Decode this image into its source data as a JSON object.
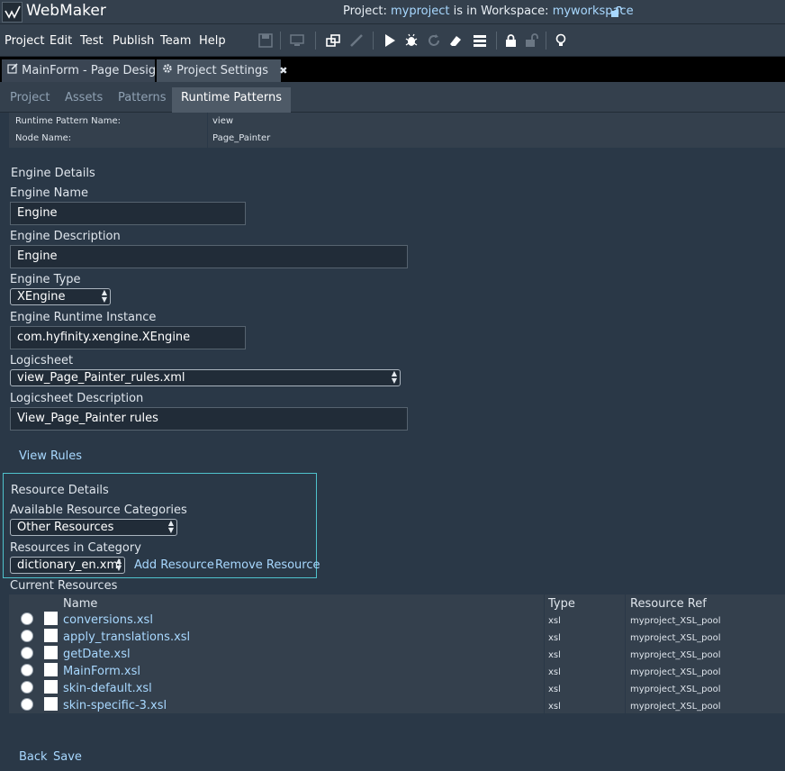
{
  "app": {
    "name": "WebMaker",
    "logo_icon": "webmaker-logo-icon"
  },
  "project_info": {
    "prefix": "Project:",
    "project": "myproject",
    "middle": "is in Workspace:",
    "workspace": "myworkspace"
  },
  "menu": [
    "Project",
    "Edit",
    "Test",
    "Publish",
    "Team",
    "Help"
  ],
  "toolbar_icons": [
    "save-icon",
    "monitor-icon",
    "windows-icon",
    "brush-icon",
    "play-icon",
    "bug-icon",
    "refresh-icon",
    "eraser-icon",
    "server-icon",
    "lock-icon",
    "unlock-icon",
    "lightbulb-icon"
  ],
  "doc_tabs": [
    {
      "label": "MainForm - Page Design",
      "icon": "edit-icon",
      "closable": false
    },
    {
      "label": "Project Settings",
      "icon": "gear-icon",
      "closable": true,
      "close_glyph": "✖"
    }
  ],
  "sub_tabs": [
    "Project",
    "Assets",
    "Patterns",
    "Runtime Patterns"
  ],
  "pattern_info": {
    "runtime_pattern_name_label": "Runtime Pattern Name:",
    "runtime_pattern_name": "view",
    "node_name_label": "Node Name:",
    "node_name": "Page_Painter"
  },
  "engine": {
    "section_title": "Engine Details",
    "name_label": "Engine Name",
    "name_value": "Engine",
    "description_label": "Engine Description",
    "description_value": "Engine",
    "type_label": "Engine Type",
    "type_value": "XEngine",
    "runtime_label": "Engine Runtime Instance",
    "runtime_value": "com.hyfinity.xengine.XEngine",
    "logicsheet_label": "Logicsheet",
    "logicsheet_value": "view_Page_Painter_rules.xml",
    "logicsheet_desc_label": "Logicsheet Description",
    "logicsheet_desc_value": "View_Page_Painter rules",
    "view_rules": "View Rules"
  },
  "resources": {
    "section_title": "Resource Details",
    "categories_label": "Available Resource Categories",
    "category_value": "Other Resources",
    "in_category_label": "Resources in Category",
    "resource_value": "dictionary_en.xml",
    "add": "Add Resource",
    "remove": "Remove Resource",
    "current_label": "Current Resources",
    "columns": [
      "Name",
      "Type",
      "Resource Ref"
    ],
    "rows": [
      {
        "name": "conversions.xsl",
        "type": "xsl",
        "ref": "myproject_XSL_pool"
      },
      {
        "name": "apply_translations.xsl",
        "type": "xsl",
        "ref": "myproject_XSL_pool"
      },
      {
        "name": "getDate.xsl",
        "type": "xsl",
        "ref": "myproject_XSL_pool"
      },
      {
        "name": "MainForm.xsl",
        "type": "xsl",
        "ref": "myproject_XSL_pool"
      },
      {
        "name": "skin-default.xsl",
        "type": "xsl",
        "ref": "myproject_XSL_pool"
      },
      {
        "name": "skin-specific-3.xsl",
        "type": "xsl",
        "ref": "myproject_XSL_pool"
      }
    ]
  },
  "footer": {
    "back": "Back",
    "save": "Save"
  }
}
